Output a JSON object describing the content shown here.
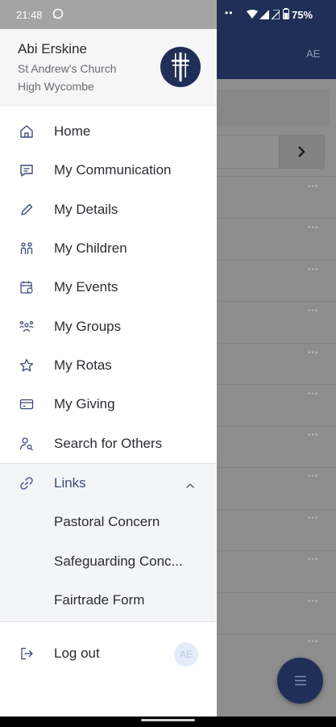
{
  "status_bar": {
    "time": "21:48",
    "battery": "75%"
  },
  "background_app": {
    "header_initials": "AE"
  },
  "profile": {
    "name": "Abi Erskine",
    "church": "St Andrew's Church",
    "location": "High Wycombe"
  },
  "menu": {
    "items": [
      {
        "label": "Home",
        "icon": "home-icon"
      },
      {
        "label": "My Communication",
        "icon": "message-icon"
      },
      {
        "label": "My Details",
        "icon": "pencil-icon"
      },
      {
        "label": "My Children",
        "icon": "children-icon"
      },
      {
        "label": "My Events",
        "icon": "calendar-icon"
      },
      {
        "label": "My Groups",
        "icon": "group-icon"
      },
      {
        "label": "My Rotas",
        "icon": "star-icon"
      },
      {
        "label": "My Giving",
        "icon": "card-icon"
      },
      {
        "label": "Search for Others",
        "icon": "person-search-icon"
      }
    ],
    "links": {
      "label": "Links",
      "items": [
        "Pastoral Concern",
        "Safeguarding Conc...",
        "Fairtrade Form"
      ]
    },
    "logout": {
      "label": "Log out",
      "avatar_initials": "AE"
    }
  },
  "colors": {
    "brand_navy": "#1f2f57",
    "icon_blue": "#3b4a7a",
    "avatar_bg": "#e3ecf8",
    "avatar_text": "#b9cbe6"
  }
}
